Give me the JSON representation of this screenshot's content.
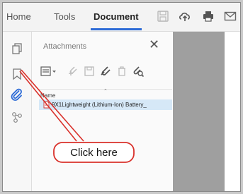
{
  "menubar": {
    "home": "Home",
    "tools": "Tools",
    "document": "Document"
  },
  "panel": {
    "title": "Attachments",
    "column_name": "Name",
    "file_name": "9X1Lightweight (Lithium-Ion) Battery_"
  },
  "callout": {
    "label": "Click here",
    "border_color": "#d9312b",
    "fill_color": "#ffffff"
  },
  "colors": {
    "accent": "#2d6bd6",
    "selection": "#d6e8f7",
    "document_area": "#9f9f9f"
  },
  "icons": {
    "menubar": [
      "save-icon",
      "upload-cloud-icon",
      "print-icon",
      "mail-icon"
    ],
    "strip": [
      "pages-icon",
      "bookmark-icon",
      "attachment-paperclip-icon",
      "layers-icon"
    ],
    "panel_tools": [
      "options-dropdown-icon",
      "add-file-icon",
      "save-attachment-icon",
      "open-attachment-icon",
      "delete-icon",
      "search-attachment-icon"
    ]
  }
}
